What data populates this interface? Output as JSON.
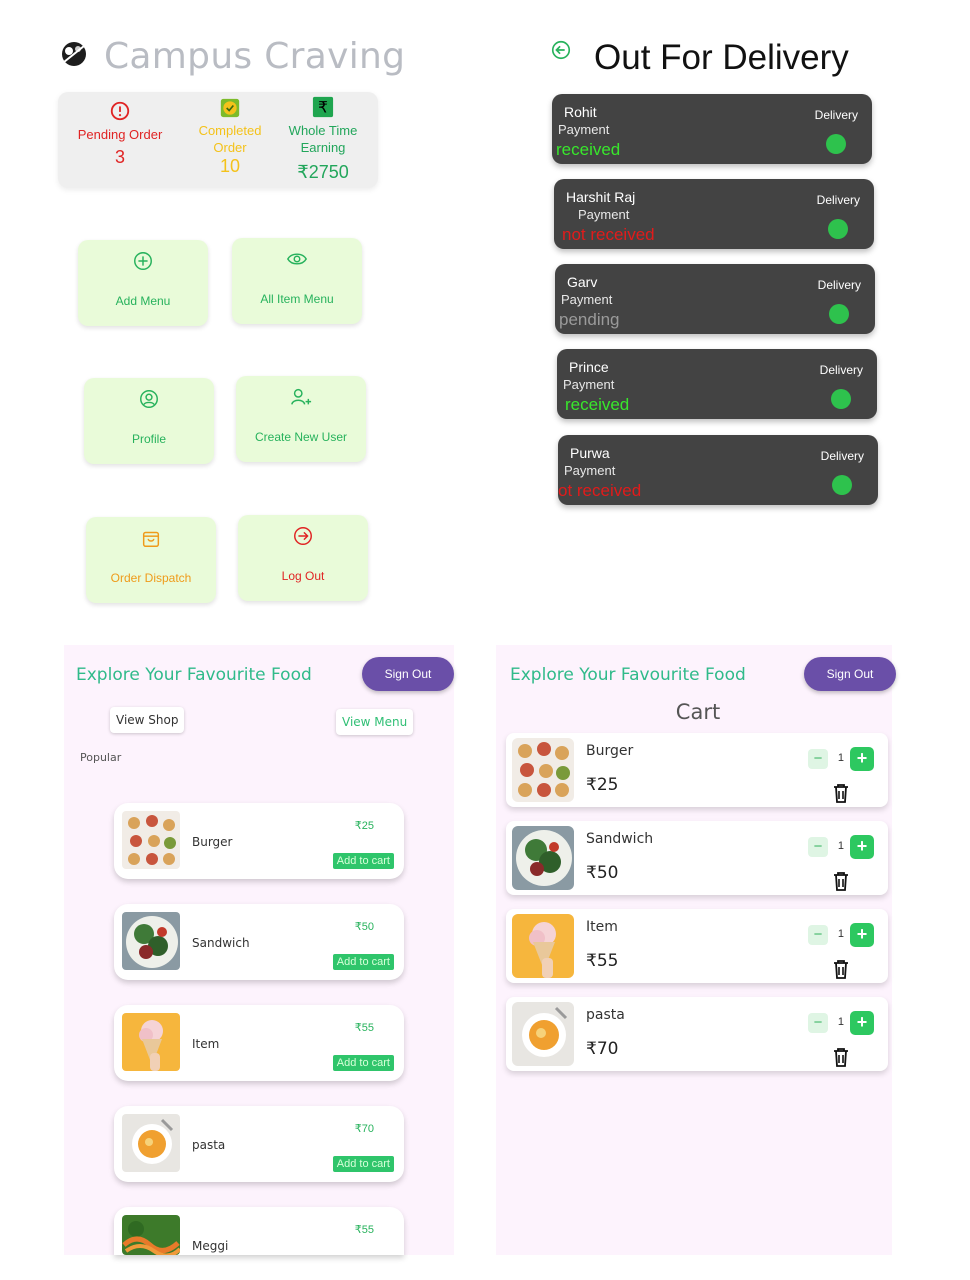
{
  "admin": {
    "app_title": "Campus Craving",
    "stats": {
      "pending": {
        "label": "Pending Order",
        "value": "3",
        "icon": "alert-circle-icon",
        "color": "#e02424"
      },
      "completed": {
        "label_line1": "Completed",
        "label_line2": "Order",
        "value": "10",
        "icon": "check-circle-icon",
        "color": "#f4c21a"
      },
      "earning": {
        "label_line1": "Whole Time",
        "label_line2": "Earning",
        "value": "₹2750",
        "icon": "rupee-icon",
        "color": "#22a65b"
      }
    },
    "tiles": [
      {
        "label": "Add Menu",
        "icon": "plus-circle-icon"
      },
      {
        "label": "All Item Menu",
        "icon": "eye-icon"
      },
      {
        "label": "Profile",
        "icon": "user-circle-icon"
      },
      {
        "label": "Create New User",
        "icon": "user-plus-icon"
      },
      {
        "label": "Order Dispatch",
        "icon": "shopping-bag-icon"
      },
      {
        "label": "Log Out",
        "icon": "logout-icon"
      }
    ]
  },
  "delivery": {
    "title": "Out For Delivery",
    "payment_label": "Payment",
    "delivery_label": "Delivery",
    "orders": [
      {
        "name": "Rohit",
        "status": "received"
      },
      {
        "name": "Harshit Raj",
        "status": "not received"
      },
      {
        "name": "Garv",
        "status": "pending"
      },
      {
        "name": "Prince",
        "status": "received"
      },
      {
        "name": "Purwa",
        "status": "ot received"
      }
    ]
  },
  "shop": {
    "header": "Explore Your Favourite Food",
    "sign_out": "Sign Out",
    "view_shop": "View Shop",
    "view_menu": "View Menu",
    "popular": "Popular",
    "add_to_cart": "Add to cart",
    "items": [
      {
        "name": "Burger",
        "price": "₹25"
      },
      {
        "name": "Sandwich",
        "price": "₹50"
      },
      {
        "name": "Item",
        "price": "₹55"
      },
      {
        "name": "pasta",
        "price": "₹70"
      },
      {
        "name": "Meggi",
        "price": "₹55"
      }
    ]
  },
  "cart": {
    "header": "Explore Your Favourite Food",
    "sign_out": "Sign Out",
    "title": "Cart",
    "items": [
      {
        "name": "Burger",
        "price": "₹25",
        "qty": "1"
      },
      {
        "name": "Sandwich",
        "price": "₹50",
        "qty": "1"
      },
      {
        "name": "Item",
        "price": "₹55",
        "qty": "1"
      },
      {
        "name": "pasta",
        "price": "₹70",
        "qty": "1"
      }
    ]
  }
}
